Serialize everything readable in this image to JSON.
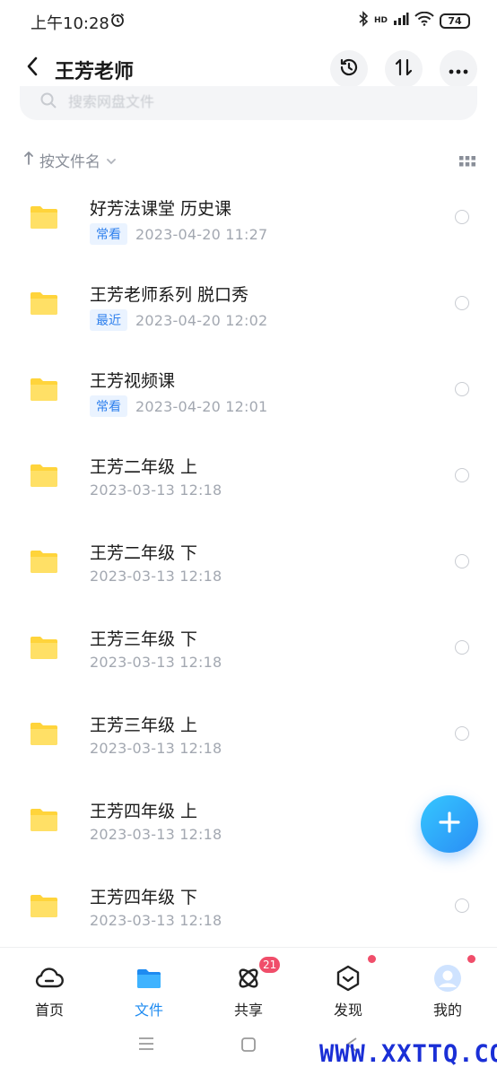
{
  "status_bar": {
    "time": "上午10:28",
    "battery": "74",
    "network": "HD"
  },
  "header": {
    "title": "王芳老师",
    "icons": [
      "back-icon",
      "history-icon",
      "sort-swap-icon",
      "more-icon"
    ]
  },
  "search": {
    "placeholder": "搜索网盘文件"
  },
  "sort": {
    "label": "按文件名"
  },
  "files": [
    {
      "name": "好芳法课堂 历史课",
      "tag": "常看",
      "date": "2023-04-20  11:27"
    },
    {
      "name": "王芳老师系列 脱口秀",
      "tag": "最近",
      "date": "2023-04-20  12:02"
    },
    {
      "name": "王芳视频课",
      "tag": "常看",
      "date": "2023-04-20  12:01"
    },
    {
      "name": "王芳二年级 上",
      "tag": "",
      "date": "2023-03-13  12:18"
    },
    {
      "name": "王芳二年级 下",
      "tag": "",
      "date": "2023-03-13  12:18"
    },
    {
      "name": "王芳三年级 下",
      "tag": "",
      "date": "2023-03-13  12:18"
    },
    {
      "name": "王芳三年级  上",
      "tag": "",
      "date": "2023-03-13  12:18"
    },
    {
      "name": "王芳四年级 上",
      "tag": "",
      "date": "2023-03-13  12:18"
    },
    {
      "name": "王芳四年级 下",
      "tag": "",
      "date": "2023-03-13  12:18"
    }
  ],
  "bottom_nav": [
    {
      "label": "首页",
      "icon": "cloud-home-icon",
      "active": false
    },
    {
      "label": "文件",
      "icon": "folder-icon",
      "active": true
    },
    {
      "label": "共享",
      "icon": "share-orbit-icon",
      "badge": "21"
    },
    {
      "label": "发现",
      "icon": "discover-cube-icon",
      "dot": true
    },
    {
      "label": "我的",
      "icon": "avatar-icon",
      "dot": true
    }
  ],
  "watermark": "WWW.XXTTQ.COM",
  "colors": {
    "accent": "#1e8bf1",
    "folder": "#ffd43b",
    "badge": "#f04e6a",
    "tag_bg": "#eaf3ff",
    "tag_text": "#2f80ed"
  }
}
